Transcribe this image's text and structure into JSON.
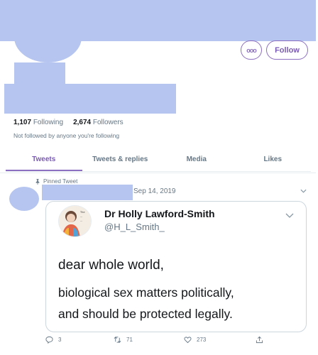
{
  "profile": {
    "follow_label": "Follow",
    "more_label": "ooo",
    "following_count": "1,107",
    "following_label": "Following",
    "followers_count": "2,674",
    "followers_label": "Followers",
    "not_followed_text": "Not followed by anyone you're following"
  },
  "tabs": [
    {
      "label": "Tweets",
      "active": true
    },
    {
      "label": "Tweets & replies",
      "active": false
    },
    {
      "label": "Media",
      "active": false
    },
    {
      "label": "Likes",
      "active": false
    }
  ],
  "tweet": {
    "pinned_label": "Pinned Tweet",
    "date": "Sep 14, 2019",
    "quote": {
      "name": "Dr Holly Lawford-Smith",
      "handle": "@H_L_Smith_",
      "line1": "dear whole world,",
      "line2": "biological sex matters politically,",
      "line3": "and should be protected legally."
    },
    "actions": {
      "replies": "3",
      "retweets": "71",
      "likes": "273"
    }
  },
  "colors": {
    "accent": "#8c6fc0",
    "redaction": "#b5c5ef",
    "muted": "#657786"
  }
}
